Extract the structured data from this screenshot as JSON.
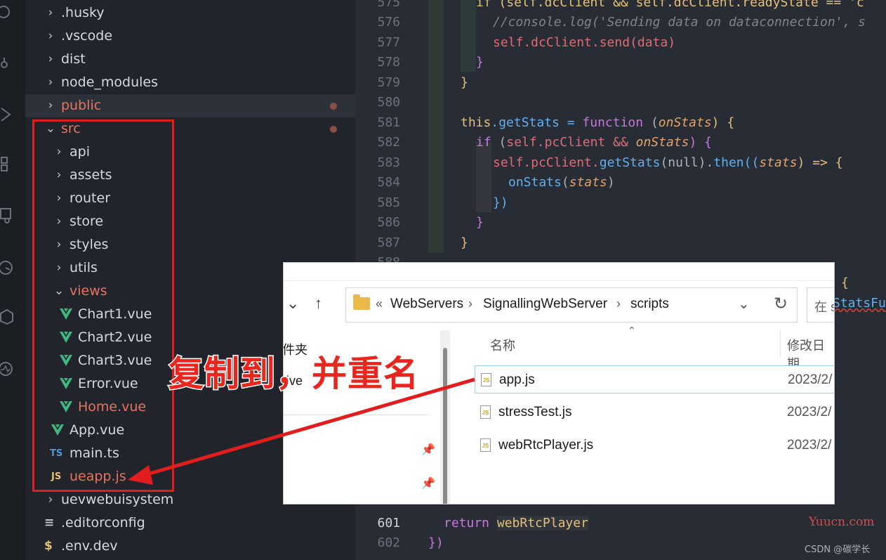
{
  "sidebar": {
    "items": [
      {
        "label": ".husky",
        "kind": "folder"
      },
      {
        "label": ".vscode",
        "kind": "folder"
      },
      {
        "label": "dist",
        "kind": "folder"
      },
      {
        "label": "node_modules",
        "kind": "folder"
      },
      {
        "label": "public",
        "kind": "folder",
        "modified": true
      },
      {
        "label": "src",
        "kind": "folder-open",
        "modified": true
      },
      {
        "label": "api",
        "kind": "folder"
      },
      {
        "label": "assets",
        "kind": "folder"
      },
      {
        "label": "router",
        "kind": "folder"
      },
      {
        "label": "store",
        "kind": "folder"
      },
      {
        "label": "styles",
        "kind": "folder"
      },
      {
        "label": "utils",
        "kind": "folder"
      },
      {
        "label": "views",
        "kind": "folder-open",
        "modified": true
      },
      {
        "label": "Chart1.vue",
        "kind": "vue-file"
      },
      {
        "label": "Chart2.vue",
        "kind": "vue-file"
      },
      {
        "label": "Chart3.vue",
        "kind": "vue-file"
      },
      {
        "label": "Error.vue",
        "kind": "vue-file"
      },
      {
        "label": "Home.vue",
        "kind": "vue-file",
        "modified": true
      },
      {
        "label": "App.vue",
        "kind": "vue-file"
      },
      {
        "label": "main.ts",
        "kind": "ts-file",
        "icon_text": "TS"
      },
      {
        "label": "ueapp.js",
        "kind": "js-file",
        "icon_text": "JS",
        "modified": true
      },
      {
        "label": "uevwebuisystem",
        "kind": "folder"
      },
      {
        "label": ".editorconfig",
        "kind": "config-file",
        "icon_text": "≡"
      },
      {
        "label": ".env.dev",
        "kind": "env-file",
        "icon_text": "$"
      }
    ]
  },
  "editor": {
    "line_numbers": [
      "575",
      "576",
      "577",
      "578",
      "579",
      "580",
      "581",
      "582",
      "583",
      "584",
      "585",
      "586",
      "587",
      "588",
      "601",
      "602"
    ],
    "current_line": "601",
    "lines": {
      "l575": "if (self.dcClient && self.dcClient.readyState == 'c",
      "l576": "//console.log('Sending data on dataconnection', s",
      "l577": "self.dcClient.send(data)",
      "l578": "}",
      "l579": "}",
      "l581_a": "this",
      "l581_b": ".getStats = ",
      "l581_c": "function",
      "l581_d": " (",
      "l581_e": "onStats",
      "l581_f": ") {",
      "l582_a": "if",
      "l582_b": " (",
      "l582_c": "self",
      "l582_d": ".pcClient && ",
      "l582_e": "onStats",
      "l582_f": ") {",
      "l583_a": "self",
      "l583_b": ".pcClient.",
      "l583_c": "getStats",
      "l583_d": "(null).",
      "l583_e": "then",
      "l583_f": "((",
      "l583_g": "stats",
      "l583_h": ") => {",
      "l584_a": "onStats",
      "l584_b": "(",
      "l584_c": "stats",
      "l584_d": ")",
      "l585": "})",
      "l586": "}",
      "l587": "}",
      "l_brace": "{",
      "l_statsfu": "StatsFu",
      "l601_a": "return",
      "l601_b": "webRtcPlayer",
      "l602": "})"
    }
  },
  "explorer": {
    "back_icon": "chevron-down",
    "up_icon": "↑",
    "address": {
      "prefix": "«",
      "segments": [
        "WebServers",
        "SignallingWebServer",
        "scripts"
      ]
    },
    "search_placeholder": "在 s",
    "nav_items": [
      "件夹",
      "rive"
    ],
    "columns": {
      "name": "名称",
      "modified": "修改日期"
    },
    "files": [
      {
        "name": "app.js",
        "date": "2023/2/",
        "selected": true
      },
      {
        "name": "stressTest.js",
        "date": "2023/2/"
      },
      {
        "name": "webRtcPlayer.js",
        "date": "2023/2/"
      }
    ]
  },
  "annotation": {
    "text": "复制到，并重名",
    "color": "#e8261e"
  },
  "watermarks": {
    "site": "Yuucn.com",
    "author": "CSDN @碳学长"
  },
  "colors": {
    "highlight_box": "#e11d1d",
    "modified_text": "#e8735f",
    "vue_green": "#41b883"
  }
}
